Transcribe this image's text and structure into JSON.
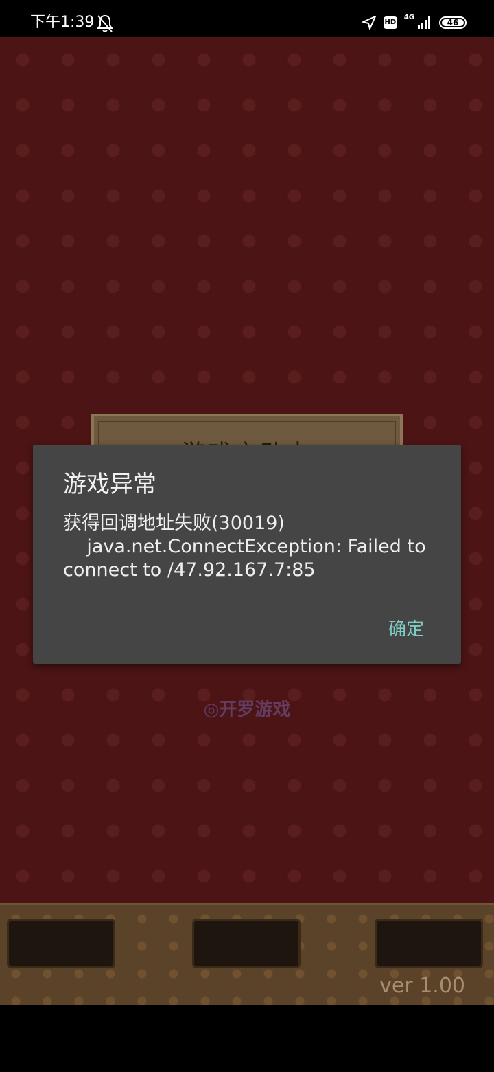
{
  "status_bar": {
    "time": "下午1:39",
    "hd": "HD",
    "network": "4G",
    "battery": "46",
    "battery_level": 0.46
  },
  "game": {
    "loading_text": "游戏启动中",
    "copyright": "◎开罗游戏",
    "version": "ver 1.00"
  },
  "dialog": {
    "title": "游戏异常",
    "message": "获得回调地址失败(30019)\n    java.net.ConnectException: Failed to connect to /47.92.167.7:85",
    "ok_label": "确定",
    "accent_color": "#80cbc4"
  }
}
